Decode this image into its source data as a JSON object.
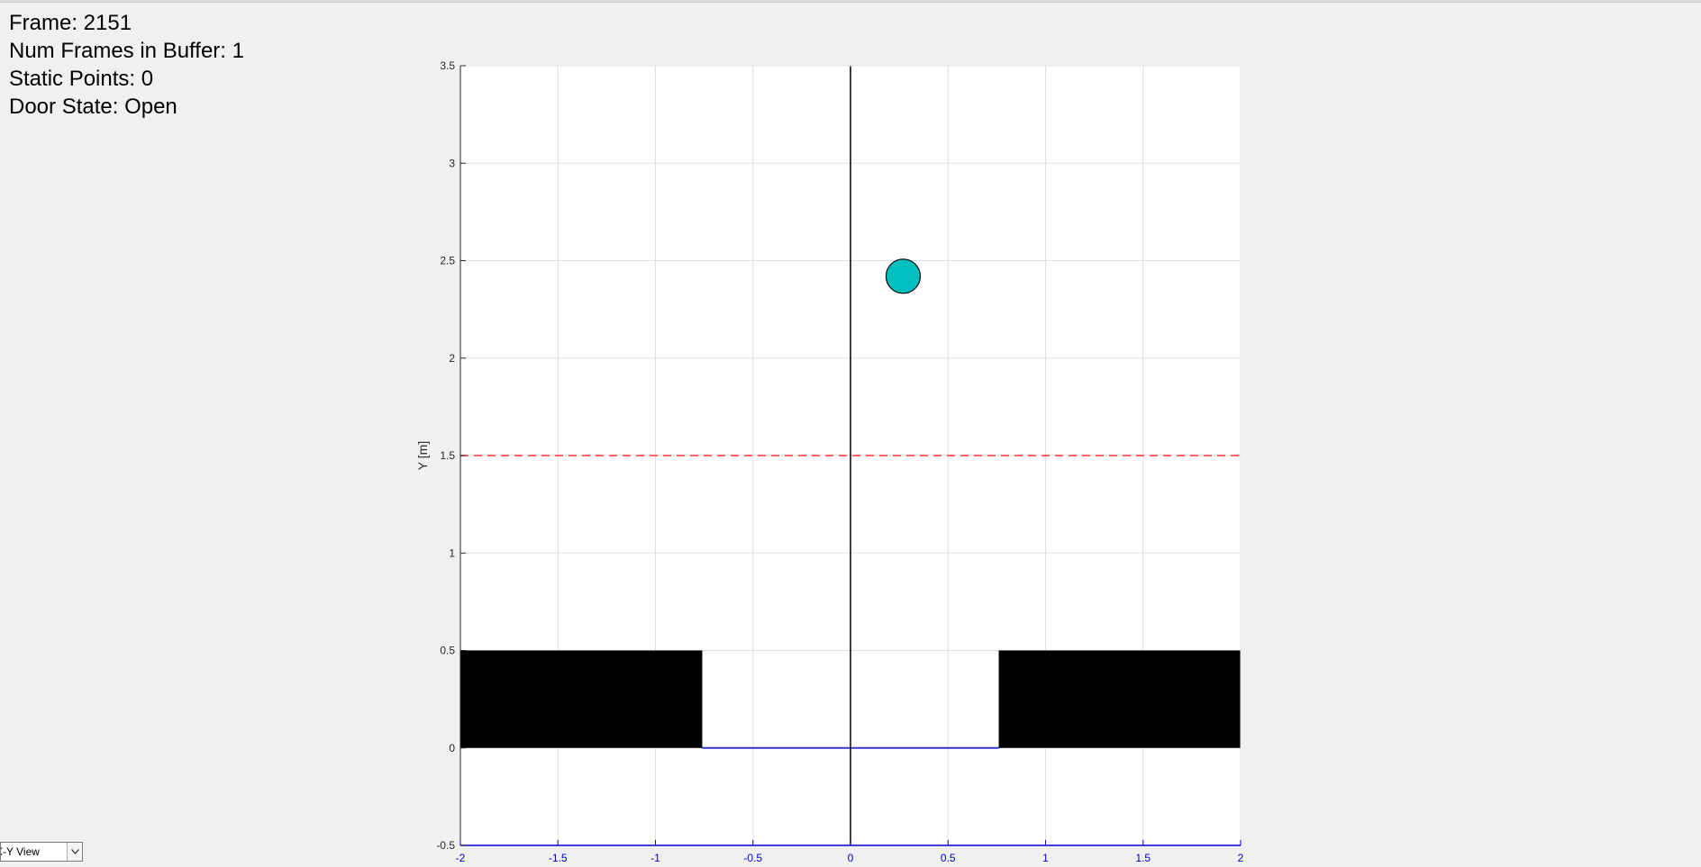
{
  "status": {
    "frame": "Frame: 2151",
    "num_frames": "Num Frames in Buffer: 1",
    "static_points": "Static Points: 0",
    "door_state": "Door State: Open"
  },
  "view_select": {
    "selected": "X-Y View",
    "arrow_icon": "chevron-down-icon"
  },
  "chart_data": {
    "type": "scatter",
    "title": "",
    "xlabel": "",
    "ylabel": "Y [m]",
    "xlim": [
      -2,
      2
    ],
    "ylim": [
      -0.5,
      3.5
    ],
    "x_ticks": [
      -2,
      -1.5,
      -1,
      -0.5,
      0,
      0.5,
      1,
      1.5,
      2
    ],
    "x_tick_labels": [
      "-2",
      "-1.5",
      "-1",
      "-0.5",
      "0",
      "0.5",
      "1",
      "1.5",
      "2"
    ],
    "y_ticks": [
      -0.5,
      0,
      0.5,
      1,
      1.5,
      2,
      2.5,
      3,
      3.5
    ],
    "y_tick_labels": [
      "-0.5",
      "0",
      "0.5",
      "1",
      "1.5",
      "2",
      "2.5",
      "3",
      "3.5"
    ],
    "grid": true,
    "x_axis_color": "#0000cc",
    "points": [
      {
        "x": 0.27,
        "y": 2.42,
        "color": "#00bfbf"
      }
    ],
    "walls": [
      {
        "x0": -2,
        "x1": -0.76,
        "y0": 0,
        "y1": 0.5,
        "color": "#000000"
      },
      {
        "x0": 0.76,
        "x1": 2,
        "y0": 0,
        "y1": 0.5,
        "color": "#000000"
      }
    ],
    "door_line": {
      "x0": -0.76,
      "x1": 0.76,
      "y": 0,
      "color": "#3333cc"
    },
    "center_line": {
      "x": 0,
      "y0": -0.5,
      "y1": 3.5,
      "color": "#000000"
    },
    "threshold_line": {
      "y": 1.5,
      "x0": -2,
      "x1": 2,
      "color": "#ff4d4d",
      "style": "dashed"
    }
  }
}
